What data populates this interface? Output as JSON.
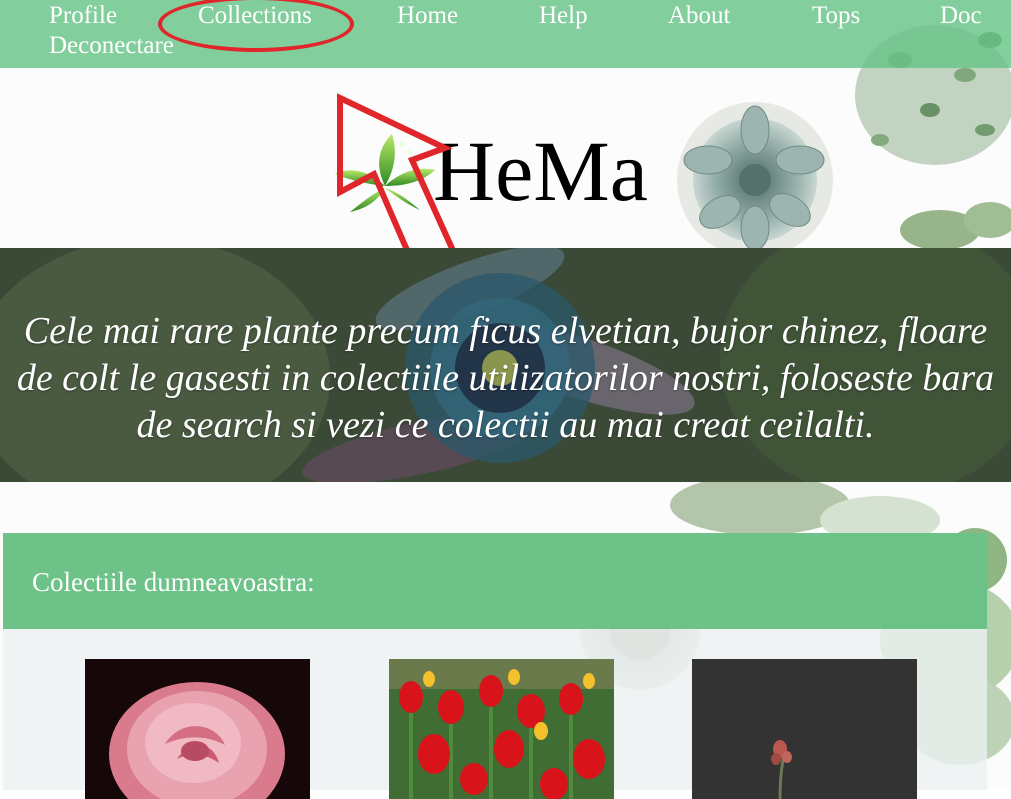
{
  "nav": {
    "items": [
      {
        "label": "Profile"
      },
      {
        "label": "Collections"
      },
      {
        "label": "Home"
      },
      {
        "label": "Help"
      },
      {
        "label": "About"
      },
      {
        "label": "Tops"
      },
      {
        "label": "Doc"
      },
      {
        "label": "Deconectare"
      }
    ],
    "highlighted": "Collections"
  },
  "brand": {
    "name": "HeMa",
    "logo_icon": "leaf-icon"
  },
  "hero": {
    "text": "Cele mai rare plante precum ficus elvetian, bujor chinez, floare de colt le gasesti in colectiile utilizatorilor nostri, foloseste bara de search si vezi ce colectii au mai creat ceilalti."
  },
  "collections": {
    "title": "Colectiile dumneavoastra:",
    "cards": [
      {
        "image": "pink-rose-image"
      },
      {
        "image": "red-tulips-image"
      },
      {
        "image": "dark-flower-image"
      }
    ]
  },
  "colors": {
    "nav_bg": "#68c387",
    "header_bg": "#62be7e",
    "annotation": "#e0262a",
    "hero_overlay": "#2f3b2f"
  }
}
